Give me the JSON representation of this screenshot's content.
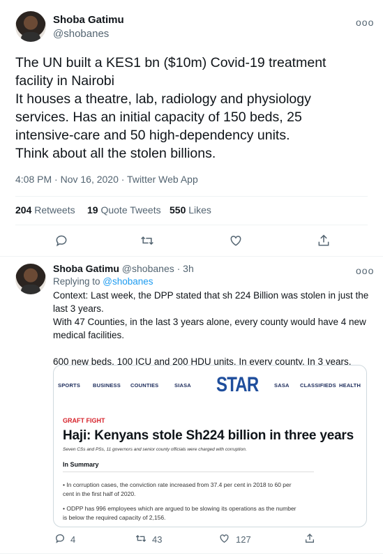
{
  "tweet": {
    "name": "Shoba Gatimu",
    "handle": "@shobanes",
    "more": "ooo",
    "text": "The UN built a KES1 bn ($10m) Covid-19 treatment\nfacility in Nairobi\nIt houses a theatre, lab, radiology and physiology\nservices. Has an initial capacity of 150 beds, 25\nintensive-care and 50 high-dependency units.\nThink about all the stolen billions.",
    "meta": "4:08 PM · Nov 16, 2020 · Twitter Web App",
    "retweets_count": "204",
    "retweets_label": "Retweets",
    "quotes_count": "19",
    "quotes_label": "Quote Tweets",
    "likes_count": "550",
    "likes_label": "Likes"
  },
  "reply": {
    "name": "Shoba Gatimu",
    "handle_time": "@shobanes · 3h",
    "more": "ooo",
    "replying_prefix": "Replying to ",
    "replying_to": "@shobanes",
    "text": "Context: Last week, the DPP stated that sh 224 Billion was stolen in just the\nlast 3 years.\nWith 47 Counties, in the last 3 years alone, every county would have 4 new\nmedical facilities.\n\n600 new beds, 100 ICU and 200 HDU units. In every county. In 3 years.",
    "card": {
      "nav_left": [
        "SPORTS",
        "BUSINESS",
        "COUNTIES",
        "SIASA"
      ],
      "logo": "STAR",
      "nav_right": [
        "SASA",
        "CLASSIFIEDS",
        "HEALTH"
      ],
      "kicker": "GRAFT FIGHT",
      "headline": "Haji: Kenyans stole Sh224 billion in three years",
      "deck": "Seven CSs and PSs, 11 governors and senior county officials were charged with corruption.",
      "summary_heading": "In Summary",
      "bullets": [
        "• In corruption cases, the conviction rate increased from 37.4 per cent in 2018 to 60 per\ncent in the first half of 2020.",
        "• ODPP has 996 employees which are argued to be slowing its operations as the number\nis below the required capacity of 2,156."
      ]
    },
    "replies_count": "4",
    "retweets_count": "43",
    "likes_count": "127"
  }
}
